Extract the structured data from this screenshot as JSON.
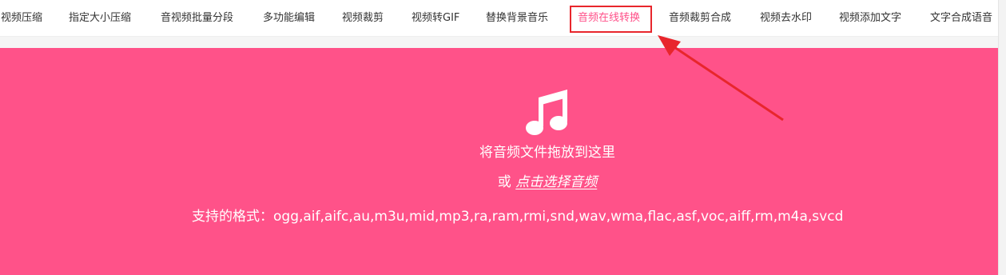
{
  "nav": {
    "items": [
      {
        "label": "视频压缩"
      },
      {
        "label": "指定大小压缩"
      },
      {
        "label": "音视频批量分段"
      },
      {
        "label": "多功能编辑"
      },
      {
        "label": "视频裁剪"
      },
      {
        "label": "视频转GIF"
      },
      {
        "label": "替换背景音乐"
      },
      {
        "label": "音频在线转换"
      },
      {
        "label": "音频裁剪合成"
      },
      {
        "label": "视频去水印"
      },
      {
        "label": "视频添加文字"
      },
      {
        "label": "文字合成语音"
      }
    ],
    "active_label": "音频在线转换"
  },
  "upload": {
    "icon": "music-note-icon",
    "drop_text": "将音频文件拖放到这里",
    "or_text": "或",
    "choose_link": "点击选择音频",
    "formats_text": "支持的格式：ogg,aif,aifc,au,m3u,mid,mp3,ra,ram,rmi,snd,wav,wma,flac,asf,voc,aiff,rm,m4a,svcd"
  },
  "annotation": {
    "icon": "arrow-icon"
  },
  "colors": {
    "accent": "#ff5289",
    "active_text": "#ff5089",
    "highlight_border": "#e8262c"
  }
}
